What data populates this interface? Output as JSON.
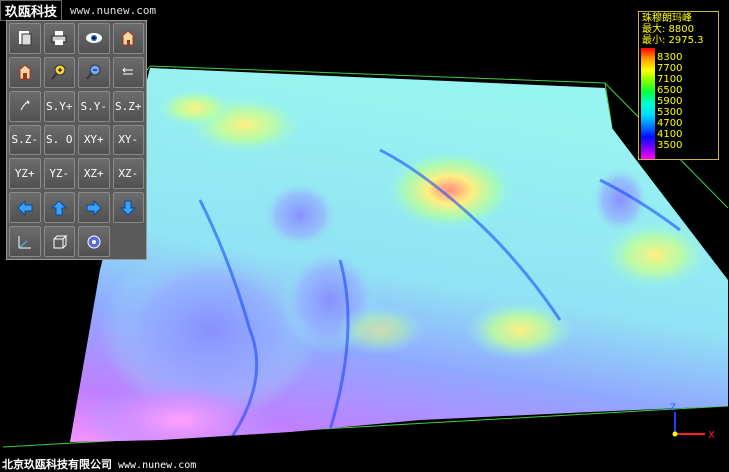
{
  "header": {
    "brand": "玖瓯科技",
    "url": "www.nunew.com"
  },
  "toolbar": {
    "row1": {
      "r1": "",
      "r2": "",
      "r3": "",
      "r4": ""
    },
    "row2": {
      "r1": "",
      "r2": "",
      "r3": "",
      "r4": ""
    },
    "row3": {
      "b1": "",
      "b2": "S.Y+",
      "b3": "S.Y-",
      "b4": "S.Z+"
    },
    "row4": {
      "b1": "S.Z-",
      "b2": "S. O",
      "b3": "XY+",
      "b4": "XY-"
    },
    "row5": {
      "b1": "YZ+",
      "b2": "YZ-",
      "b3": "XZ+",
      "b4": "XZ-"
    }
  },
  "legend": {
    "title": "珠穆朗玛峰",
    "max": "最大: 8800",
    "min": "最小: 2975.3",
    "ticks": [
      "8300",
      "7700",
      "7100",
      "6500",
      "5900",
      "5300",
      "4700",
      "4100",
      "3500"
    ],
    "colors": [
      "#ff0000",
      "#ffa000",
      "#ffff00",
      "#80ff00",
      "#00ff40",
      "#00ffd0",
      "#00e0ff",
      "#0080ff",
      "#0010ff",
      "#8000ff",
      "#ff00ff"
    ]
  },
  "footer": {
    "company": "北京玖瓯科技有限公司",
    "url": "www.nunew.com"
  },
  "axes": {
    "x": "X",
    "z": "Z"
  }
}
